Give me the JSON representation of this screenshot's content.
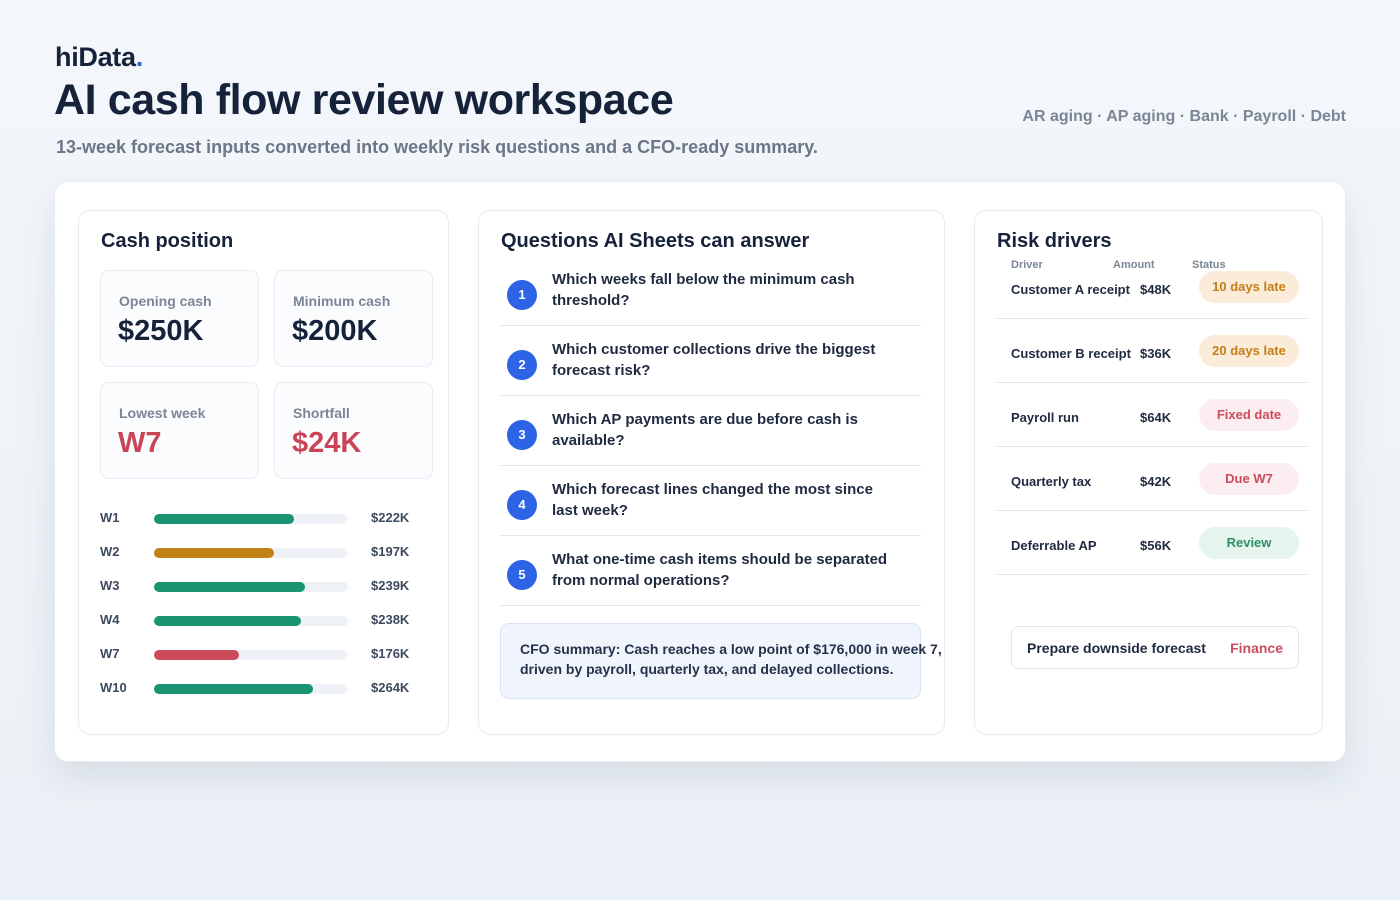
{
  "brand": {
    "name": "hiData",
    "dot": "."
  },
  "header": {
    "title": "AI cash flow review workspace",
    "subtitle": "13-week forecast inputs converted into weekly risk questions and a CFO-ready summary.",
    "sources": "AR aging · AP aging · Bank · Payroll · Debt"
  },
  "cash": {
    "title": "Cash position",
    "kpis": [
      {
        "label": "Opening cash",
        "value": "$250K",
        "alert": false
      },
      {
        "label": "Minimum cash",
        "value": "$200K",
        "alert": false
      },
      {
        "label": "Lowest week",
        "value": "W7",
        "alert": true
      },
      {
        "label": "Shortfall",
        "value": "$24K",
        "alert": true
      }
    ],
    "weeks": [
      {
        "label": "W1",
        "amount": "$222K",
        "fill": 0.72,
        "color": "#1a9470"
      },
      {
        "label": "W2",
        "amount": "$197K",
        "fill": 0.62,
        "color": "#c28216"
      },
      {
        "label": "W3",
        "amount": "$239K",
        "fill": 0.78,
        "color": "#1a9470"
      },
      {
        "label": "W4",
        "amount": "$238K",
        "fill": 0.76,
        "color": "#1a9470"
      },
      {
        "label": "W7",
        "amount": "$176K",
        "fill": 0.44,
        "color": "#cc4a59"
      },
      {
        "label": "W10",
        "amount": "$264K",
        "fill": 0.82,
        "color": "#1a9470"
      }
    ]
  },
  "questions": {
    "title": "Questions AI Sheets can answer",
    "items": [
      {
        "num": "1",
        "text": "Which weeks fall below the minimum cash threshold?"
      },
      {
        "num": "2",
        "text": "Which customer collections drive the biggest forecast risk?"
      },
      {
        "num": "3",
        "text": "Which AP payments are due before cash is available?"
      },
      {
        "num": "4",
        "text": "Which forecast lines changed the most since last week?"
      },
      {
        "num": "5",
        "text": "What one-time cash items should be separated from normal operations?"
      }
    ],
    "summary": "CFO summary: Cash reaches a low point of $176,000 in week 7, driven by payroll, quarterly tax, and delayed collections."
  },
  "risk": {
    "title": "Risk drivers",
    "columns": {
      "driver": "Driver",
      "amount": "Amount",
      "status": "Status"
    },
    "rows": [
      {
        "driver": "Customer A receipt",
        "amount": "$48K",
        "status": "10 days late",
        "tone": "late"
      },
      {
        "driver": "Customer B receipt",
        "amount": "$36K",
        "status": "20 days late",
        "tone": "late"
      },
      {
        "driver": "Payroll run",
        "amount": "$64K",
        "status": "Fixed date",
        "tone": "fixed"
      },
      {
        "driver": "Quarterly tax",
        "amount": "$42K",
        "status": "Due W7",
        "tone": "fixed"
      },
      {
        "driver": "Deferrable AP",
        "amount": "$56K",
        "status": "Review",
        "tone": "review"
      }
    ],
    "action": {
      "label": "Prepare downside forecast",
      "owner": "Finance"
    }
  }
}
